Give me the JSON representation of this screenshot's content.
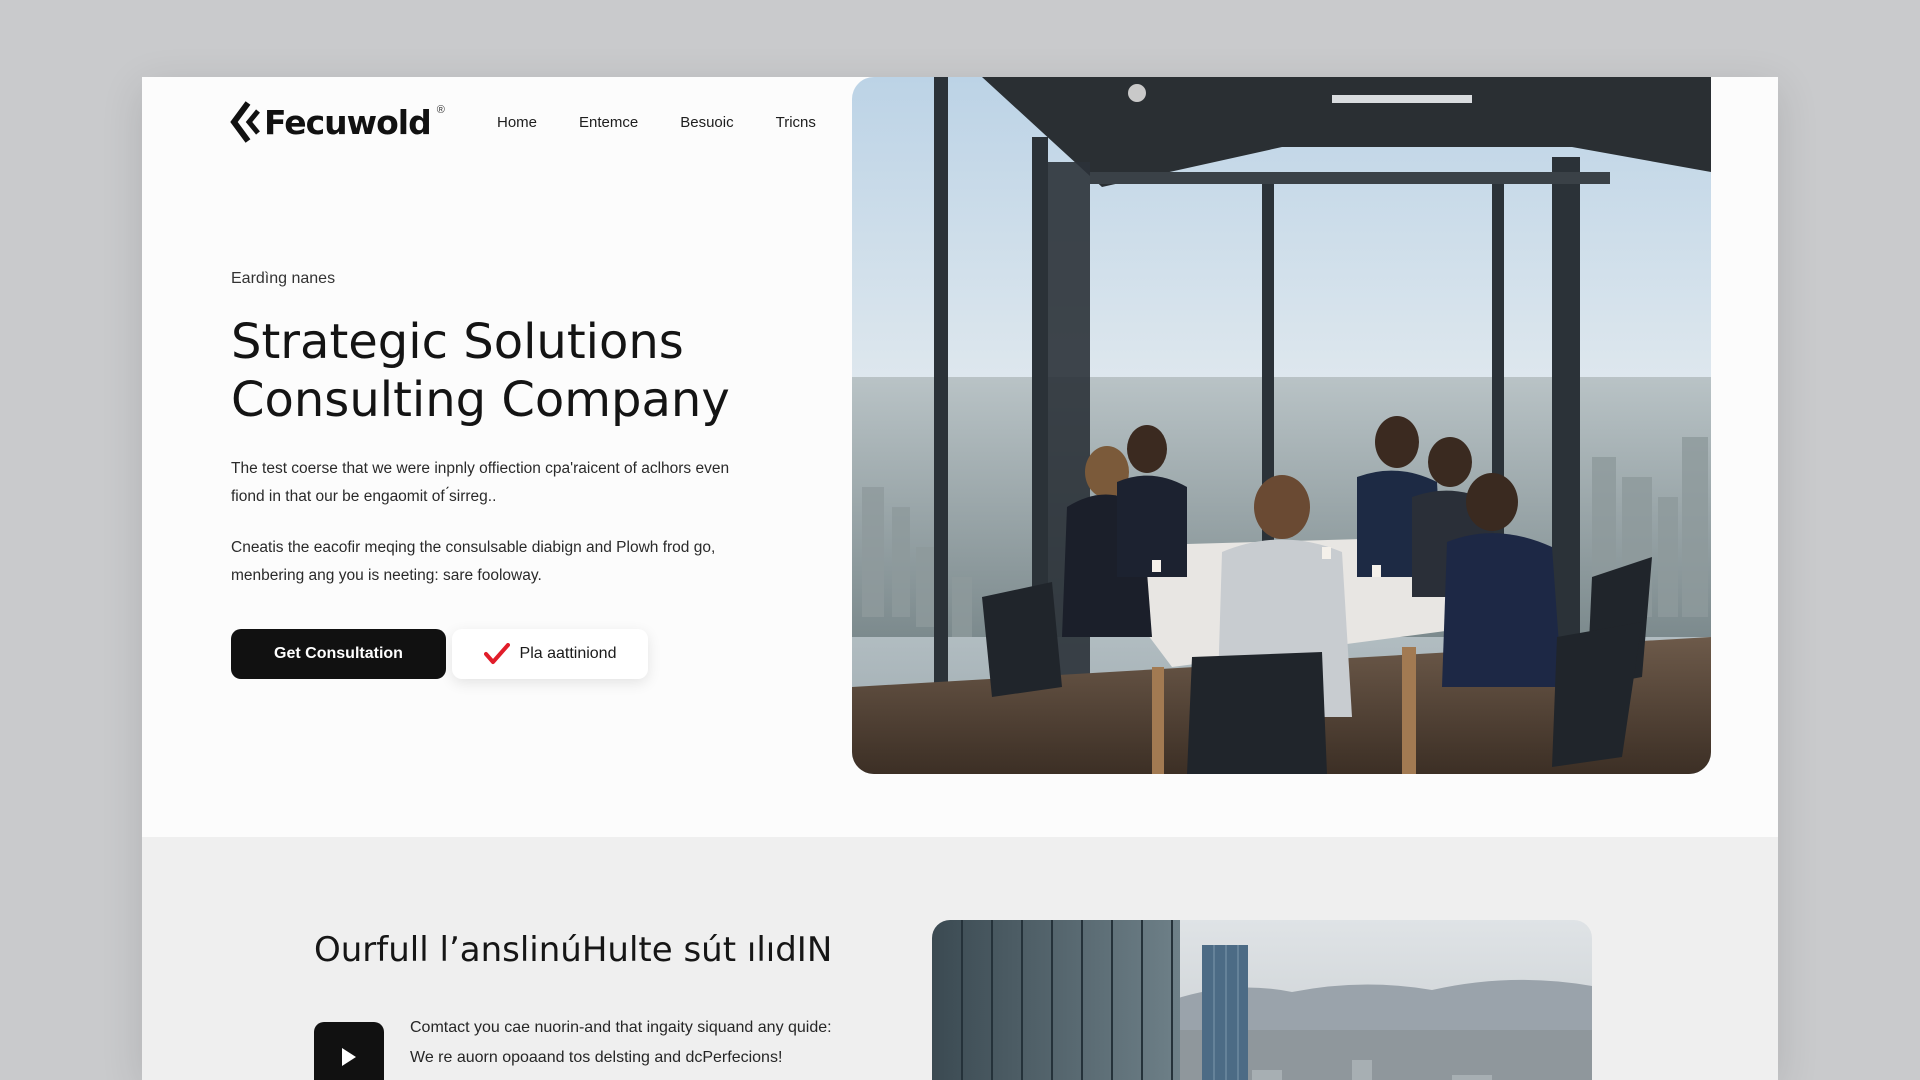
{
  "brand": {
    "name": "Fecuwold",
    "registered": "®"
  },
  "nav": {
    "items": [
      "Home",
      "Entemce",
      "Besuoic",
      "Tricns"
    ]
  },
  "hero": {
    "eyebrow": "Eardìng nanes",
    "title": " Strategic  Solutions\nConsulting Company",
    "paragraph_1": "The test coerse that we were inpnly offiection cpa'raicent of aclhors even fiond in that our be engaomit of ́sirreg..",
    "paragraph_2": "Cneatis the eacofir meqing the consulsable diabign and Plowh frod go, menbering ang you is neeting: sare fooloway.",
    "primary_button": "Get Consultation",
    "secondary_button": "Pla aattiniond",
    "photo_icon": "conference-room-photo"
  },
  "section_2": {
    "title": "Ourfull l’anslinúHulte sút ılıdIN",
    "text_line_1": "Comtact you cae nuorin-and that ingaity siquand any quide:",
    "text_line_2": "We re auorn opoaand tos delsting and dcPerfecions!",
    "play_icon": "play-icon",
    "photo_icon": "city-skyline-photo"
  },
  "colors": {
    "accent_check": "#e11d2a",
    "button_dark": "#111111",
    "backdrop": "#c9cacc"
  }
}
